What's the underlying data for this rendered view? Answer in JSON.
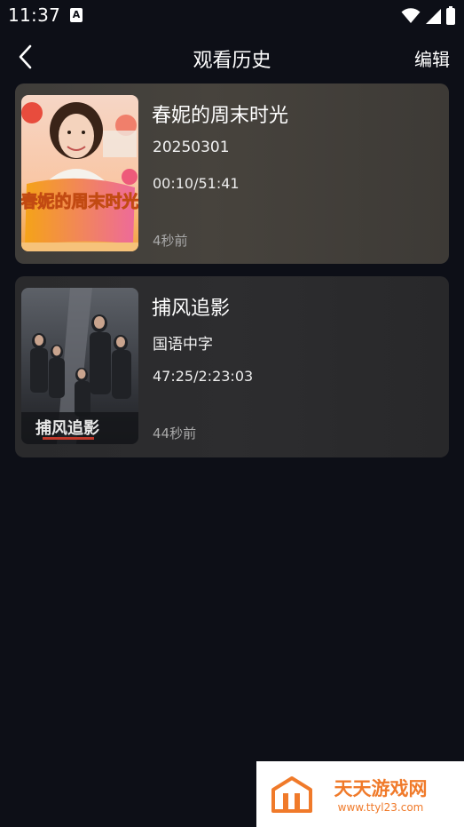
{
  "status_bar": {
    "time": "11:37",
    "notification_letter": "A"
  },
  "header": {
    "title": "观看历史",
    "edit_label": "编辑"
  },
  "history": [
    {
      "title": "春妮的周末时光",
      "subtitle": "20250301",
      "progress": "00:10/51:41",
      "watched_ago": "4秒前",
      "poster_caption": "春妮的周末时光"
    },
    {
      "title": "捕风追影",
      "subtitle": "国语中字",
      "progress": "47:25/2:23:03",
      "watched_ago": "44秒前",
      "poster_caption": "捕风追影"
    }
  ],
  "watermark": {
    "name": "天天游戏网",
    "url": "www.ttyl23.com"
  },
  "colors": {
    "background": "#0d0f17",
    "card_1": "#423f3a",
    "card_2": "#2b2b2d",
    "watermark_brand": "#f07a2a"
  }
}
